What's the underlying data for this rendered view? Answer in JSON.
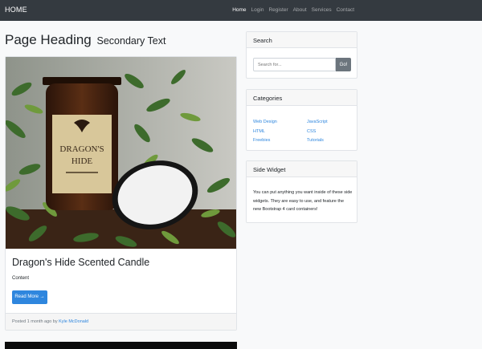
{
  "navbar": {
    "brand": "HOME",
    "links": [
      "Home",
      "Login",
      "Register",
      "About",
      "Services",
      "Contact"
    ]
  },
  "page": {
    "heading": "Page Heading",
    "subheading": "Secondary Text"
  },
  "post": {
    "image_alt": "Dragon's Hide scented candle",
    "image_label_1": "DRAGON'S",
    "image_label_2": "HIDE",
    "title": "Dragon's Hide Scented Candle",
    "content": "Content",
    "read_more": "Read More →",
    "posted_text": "Posted 1 month ago by",
    "author": "Kyle McDonald"
  },
  "search": {
    "title": "Search",
    "placeholder": "Search for...",
    "button": "Go!"
  },
  "categories": {
    "title": "Categories",
    "col1": [
      "Web Design",
      "HTML",
      "Freebies"
    ],
    "col2": [
      "JavaScript",
      "CSS",
      "Tutorials"
    ]
  },
  "side_widget": {
    "title": "Side Widget",
    "text": "You can put anything you want inside of these side widgets. They are easy to use, and feature the new Bootstrap 4 card containers!"
  },
  "colors": {
    "navbar": "#343a40",
    "primary": "#2e86de",
    "secondary": "#6c757d"
  }
}
